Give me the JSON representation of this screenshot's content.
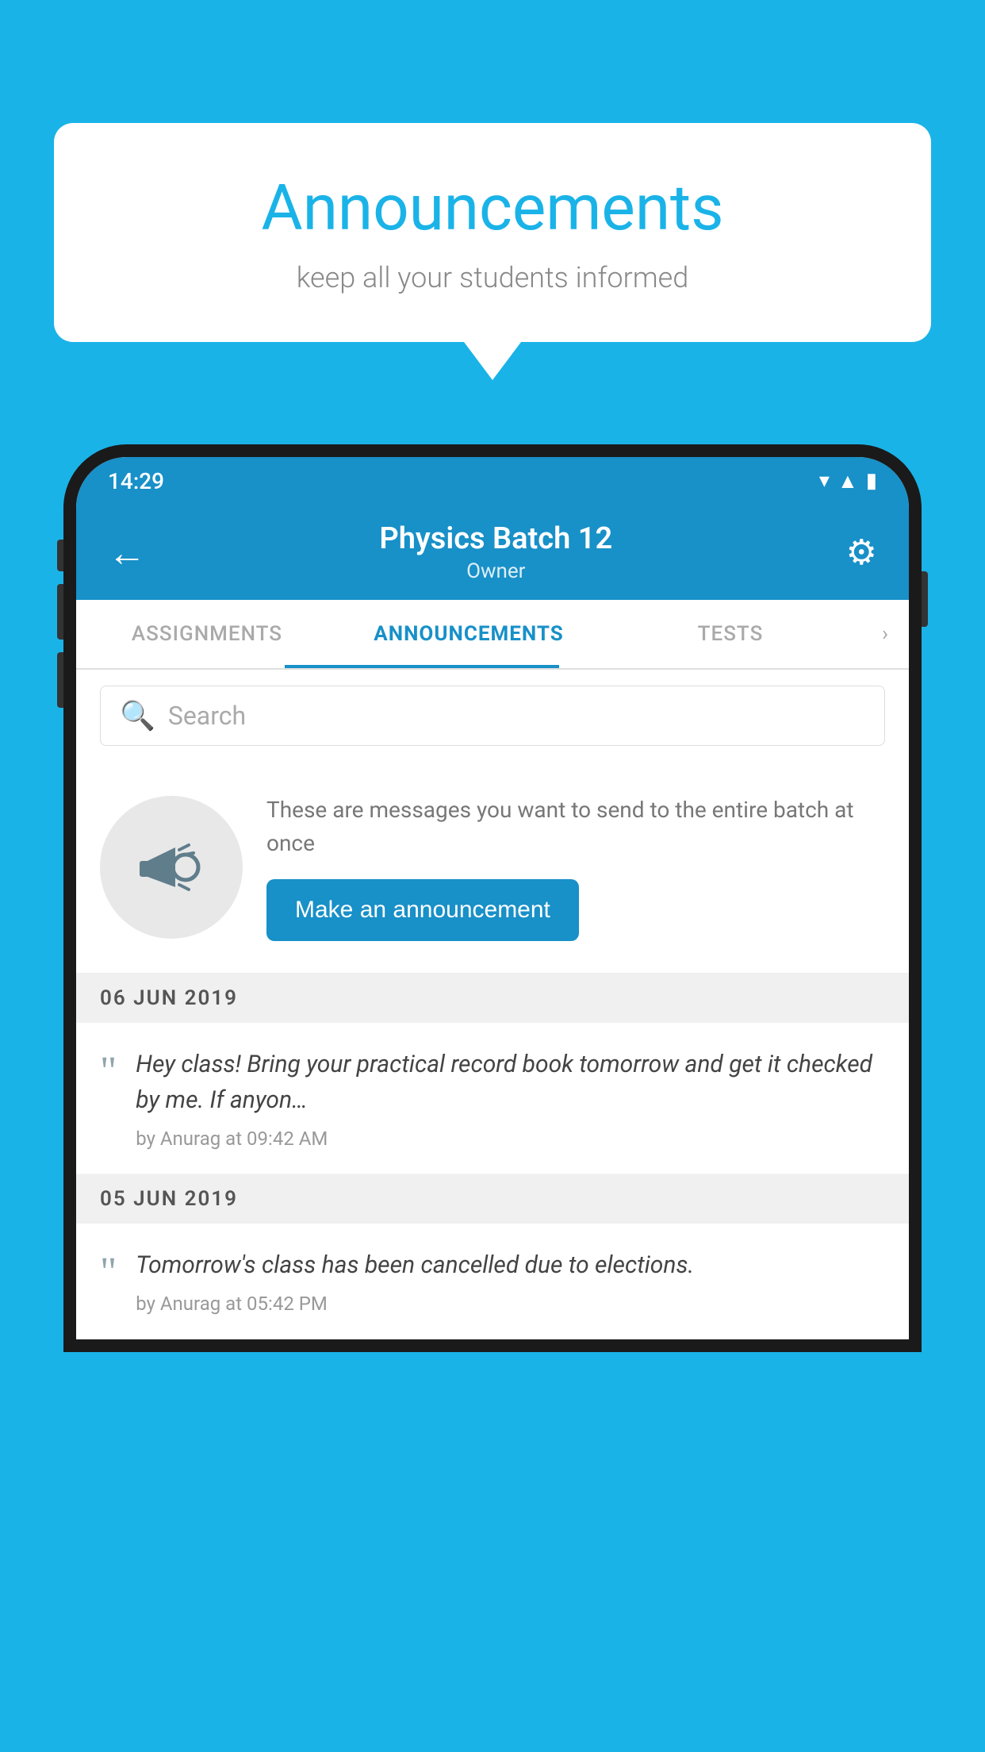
{
  "page": {
    "background_color": "#1ab3e8"
  },
  "speech_bubble": {
    "title": "Announcements",
    "subtitle": "keep all your students informed"
  },
  "status_bar": {
    "time": "14:29",
    "wifi": "▼",
    "signal": "▲",
    "battery": "▮"
  },
  "app_header": {
    "back_label": "←",
    "title": "Physics Batch 12",
    "subtitle": "Owner",
    "gear_symbol": "⚙"
  },
  "tabs": [
    {
      "label": "ASSIGNMENTS",
      "active": false
    },
    {
      "label": "ANNOUNCEMENTS",
      "active": true
    },
    {
      "label": "TESTS",
      "active": false
    },
    {
      "label": "…",
      "active": false
    }
  ],
  "search": {
    "placeholder": "Search",
    "icon": "🔍"
  },
  "announcement_prompt": {
    "description": "These are messages you want to send to the entire batch at once",
    "button_label": "Make an announcement"
  },
  "date_sections": [
    {
      "date": "06  JUN  2019",
      "announcements": [
        {
          "text": "Hey class! Bring your practical record book tomorrow and get it checked by me. If anyon…",
          "meta": "by Anurag at 09:42 AM"
        }
      ]
    },
    {
      "date": "05  JUN  2019",
      "announcements": [
        {
          "text": "Tomorrow's class has been cancelled due to elections.",
          "meta": "by Anurag at 05:42 PM"
        }
      ]
    }
  ]
}
